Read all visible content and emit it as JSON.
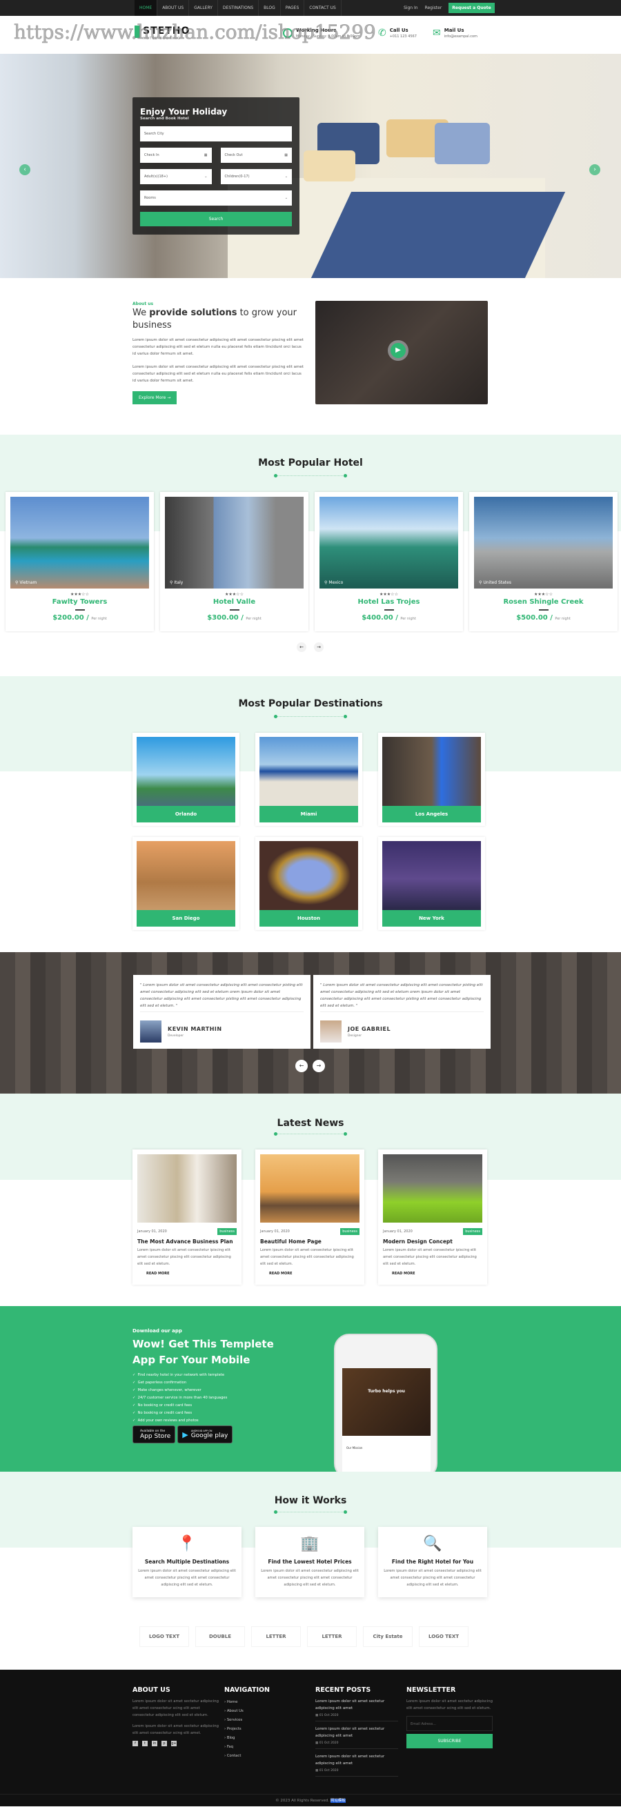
{
  "watermark": "https://www.huzhan.com/ishop15299",
  "topnav": {
    "items": [
      "HOME",
      "ABOUT US",
      "GALLERY",
      "DESTINATIONS",
      "BLOG",
      "PAGES",
      "CONTACT US"
    ],
    "signin": "Sign In",
    "register": "Register",
    "quote": "Request a Quote"
  },
  "header": {
    "logo": "STETHO",
    "logo_sub": "HOTEL BOOKING",
    "hours_title": "Working Hours",
    "hours_text": "Monday - Sunday: 9.00am to 6.00pm",
    "call_title": "Call Us",
    "call_text": "+011 123 4567",
    "mail_title": "Mail Us",
    "mail_text": "info@exampal.com"
  },
  "hero": {
    "title": "Enjoy Your Holiday",
    "subtitle": "Search and Book Hotel",
    "city": "Search City",
    "checkin": "Check In",
    "checkout": "Check Out",
    "adults": "Adult(s)(18+)",
    "children": "Children(0-17)",
    "rooms": "Rooms",
    "search": "Search"
  },
  "about": {
    "label": "About us",
    "title_pre": "We ",
    "title_bold": "provide solutions",
    "title_post": " to grow your business",
    "p1": "Lorem ipsum dolor sit amet consectetur adipiscing elit amet consectetur piscing elit amet consectetur adipiscing elit sed et eletum nulla eu placerat felis etiam tincidunt orci lacus id varius dolor fermum sit amet.",
    "p2": "Lorem ipsum dolor sit amet consectetur adipiscing elit amet consectetur piscing elit amet consectetur adipiscing elit sed et eletum nulla eu placerat felis etiam tincidunt orci lacus id varius dolor fermum sit amet.",
    "button": "Explore More"
  },
  "hotels": {
    "title": "Most Popular Hotel",
    "per": "Per night",
    "items": [
      {
        "name": "Fawlty Towers",
        "location": "Vietnam",
        "price": "$200.00 /",
        "stars": 3
      },
      {
        "name": "Hotel Valle",
        "location": "Italy",
        "price": "$300.00 /",
        "stars": 3
      },
      {
        "name": "Hotel Las Trojes",
        "location": "Mexico",
        "price": "$400.00 /",
        "stars": 3
      },
      {
        "name": "Rosen Shingle Creek",
        "location": "United States",
        "price": "$500.00 /",
        "stars": 3
      }
    ]
  },
  "destinations": {
    "title": "Most Popular Destinations",
    "items": [
      "Orlando",
      "Miami",
      "Los Angeles",
      "San Diego",
      "Houston",
      "New York"
    ]
  },
  "testimonials": [
    {
      "quote": "\" Lorem ipsum dolor sit amet consectetur adipiscing elit amet consectetur pisting elit amet consectetur adipiscing elit sed et eletum orem ipsum dolor sit amet consectetur adipiscing elit amet consectetur pisting elit amet consectetur adipiscing elit sed et eletum. \"",
      "name": "KEVIN MARTHIN",
      "role": "Developer"
    },
    {
      "quote": "\" Lorem ipsum dolor sit amet consectetur adipiscing elit amet consectetur pisting elit amet consectetur adipiscing elit sed et eletum orem ipsum dolor sit amet consectetur adipiscing elit amet consectetur pisting elit amet consectetur adipiscing elit sed et eletum. \"",
      "name": "JOE GABRIEL",
      "role": "Designer"
    }
  ],
  "news": {
    "title": "Latest News",
    "read_more": "READ MORE",
    "items": [
      {
        "date": "January 01, 2020",
        "tag": "business",
        "title": "The Most Advance Business Plan",
        "text": "Lorem ipsum dolor sit amet consectetur ipiscing elit amet consectetur piscing elit consectetur adipiscing elit sed et eletum."
      },
      {
        "date": "January 01, 2020",
        "tag": "business",
        "title": "Beautiful Home Page",
        "text": "Lorem ipsum dolor sit amet consectetur ipiscing elit amet consectetur piscing elit consectetur adipiscing elit sed et eletum."
      },
      {
        "date": "January 01, 2020",
        "tag": "business",
        "title": "Modern Design Concept",
        "text": "Lorem ipsum dolor sit amet consectetur ipiscing elit amet consectetur piscing elit consectetur adipiscing elit sed et eletum."
      }
    ]
  },
  "app": {
    "label": "Download our app",
    "title1": "Wow! Get This Templete",
    "title2": "App For Your Mobile",
    "features": [
      "Find nearby hotel in your network with templete",
      "Get paperless confirmation",
      "Make changes whenever, wherever",
      "24/7 customer service in more than 40 languages",
      "No booking or credit card fees",
      "No booking or credit card fees",
      "Add your own reviews and photos"
    ],
    "appstore_small": "Available on the",
    "appstore": "App Store",
    "gplay_small": "ANDROID APP ON",
    "gplay": "Google play",
    "phone_headline": "Turbo helps you",
    "phone_mission": "Our Mission"
  },
  "how": {
    "title": "How it Works",
    "items": [
      {
        "title": "Search Multiple Destinations",
        "text": "Lorem ipsum dolor sit amet consectetur adipiscing elit amet consectetur piscing elit amet consectetur adipiscing elit sed et eletum."
      },
      {
        "title": "Find the Lowest Hotel Prices",
        "text": "Lorem ipsum dolor sit amet consectetur adipiscing elit amet consectetur piscing elit amet consectetur adipiscing elit sed et eletum."
      },
      {
        "title": "Find the Right Hotel for You",
        "text": "Lorem ipsum dolor sit amet consectetur adipiscing elit amet consectetur piscing elit amet consectetur adipiscing elit sed et eletum."
      }
    ]
  },
  "logos": [
    "LOGO TEXT",
    "DOUBLE",
    "LETTER",
    "LETTER",
    "City Estate",
    "LOGO TEXT"
  ],
  "footer": {
    "about_title": "ABOUT US",
    "about_p1": "Lorem ipsum dolor sit amet sectetur adipiscing elit amet consectetur scing elit amet consectetur adipiscing elit sed et eletum.",
    "about_p2": "Lorem ipsum dolor sit amet sectetur adipiscing elit amet consectetur scing elit amet.",
    "nav_title": "NAVIGATION",
    "nav": [
      "Home",
      "About Us",
      "Services",
      "Projects",
      "Blog",
      "Faq",
      "Contact"
    ],
    "posts_title": "RECENT POSTS",
    "posts": [
      {
        "title": "Lorem ipsum dolor sit amet sectetur adipiscing elit amet",
        "date": "01 Oct 2020"
      },
      {
        "title": "Lorem ipsum dolor sit amet sectetur adipiscing elit amet",
        "date": "01 Oct 2020"
      },
      {
        "title": "Lorem ipsum dolor sit amet sectetur adipiscing elit amet",
        "date": "01 Oct 2020"
      }
    ],
    "news_title": "NEWSLETTER",
    "news_text": "Lorem ipsum dolor sit amet sectetur adipiscing elit amet consectetur scing elit sed et eletum.",
    "email_placeholder": "Email Adress...",
    "subscribe": "SUBSCRIBE",
    "copyright": "© 2023 All Rights Reserved.",
    "copyright_link": "网站模板"
  },
  "colors": {
    "accent": "#2fb673",
    "dark": "#111111",
    "light_band": "#e9f7f0"
  }
}
